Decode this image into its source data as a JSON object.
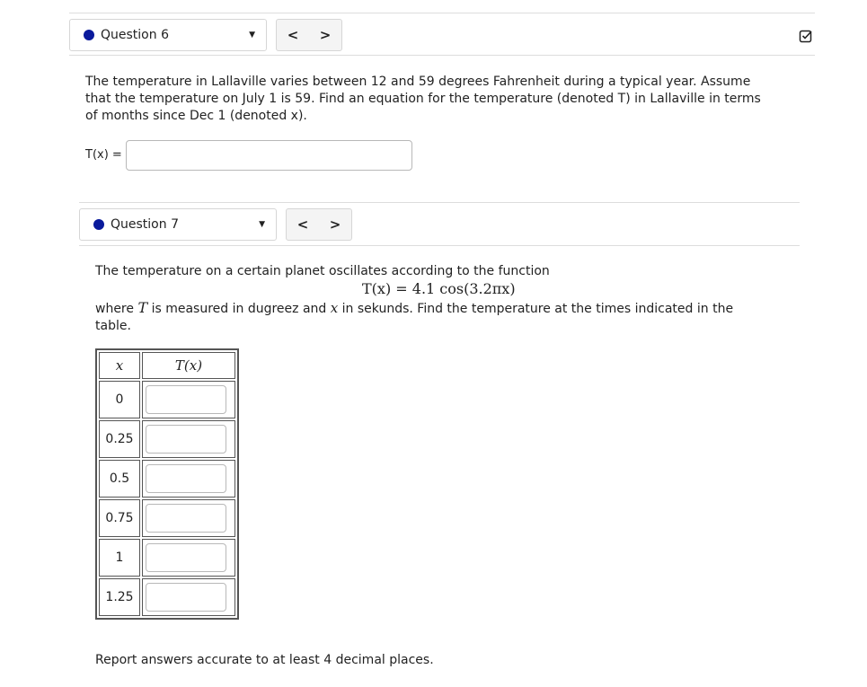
{
  "q6": {
    "question_label": "Question 6",
    "prev_label": "<",
    "next_label": ">",
    "text": "The temperature in Lallaville varies between 12 and 59 degrees Fahrenheit during a typical year. Assume that the temperature on July 1 is 59. Find an equation for the temperature (denoted T) in Lallaville in terms of months since Dec 1 (denoted x).",
    "answer_label": "T(x) =",
    "answer_value": ""
  },
  "q7": {
    "question_label": "Question 7",
    "prev_label": "<",
    "next_label": ">",
    "intro": "The temperature on a certain planet oscillates according to the function",
    "formula": "T(x) = 4.1 cos(3.2πx)",
    "text_after_1": "where",
    "var_T": "T",
    "text_after_2": "is measured in dugreez and",
    "var_x": "x",
    "text_after_3": "in sekunds. Find the temperature at the times indicated in the table.",
    "table": {
      "col1_header": "x",
      "col2_header": "T(x)",
      "rows": [
        "0",
        "0.25",
        "0.5",
        "0.75",
        "1",
        "1.25"
      ]
    },
    "footer": "Report answers accurate to at least 4 decimal places."
  },
  "icons": {
    "checklist": "checkbox-check-icon",
    "dot_color": "#0a1a9c"
  }
}
